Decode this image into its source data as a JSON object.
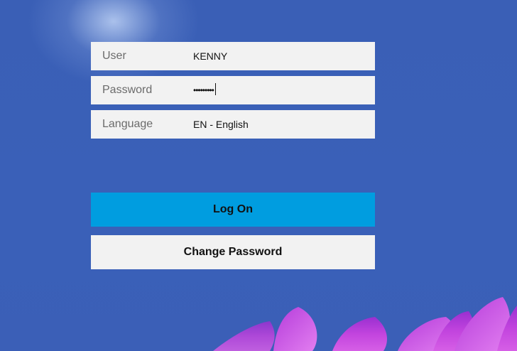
{
  "login": {
    "user": {
      "label": "User",
      "value": "KENNY"
    },
    "password": {
      "label": "Password",
      "masked": "•••••••••"
    },
    "language": {
      "label": "Language",
      "value": "EN - English"
    }
  },
  "actions": {
    "logon_label": "Log On",
    "change_password_label": "Change Password"
  },
  "colors": {
    "background": "#3b5fb7",
    "field_background": "#f2f2f2",
    "primary_button": "#009de0",
    "flower": "#c13fd6"
  }
}
